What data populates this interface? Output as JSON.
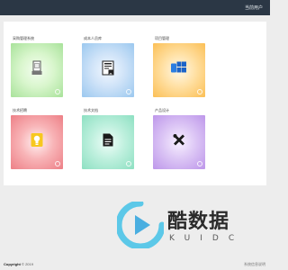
{
  "topbar": {
    "user_label": "当前用户"
  },
  "tiles": [
    {
      "label": "采购管理系统",
      "icon": "printer-icon"
    },
    {
      "label": "成本人员库",
      "icon": "document-icon"
    },
    {
      "label": "项目管理",
      "icon": "windows-icon"
    },
    {
      "label": "技术招聘",
      "icon": "lightbulb-icon"
    },
    {
      "label": "技术文档",
      "icon": "file-icon"
    },
    {
      "label": "产品设计",
      "icon": "tools-icon"
    }
  ],
  "watermark": {
    "text": "酷数据",
    "sub": "KUIDC"
  },
  "footer": {
    "copyright_word": "Copyright",
    "copyright_year": "© 2019",
    "right_text": "系统信息说明"
  }
}
